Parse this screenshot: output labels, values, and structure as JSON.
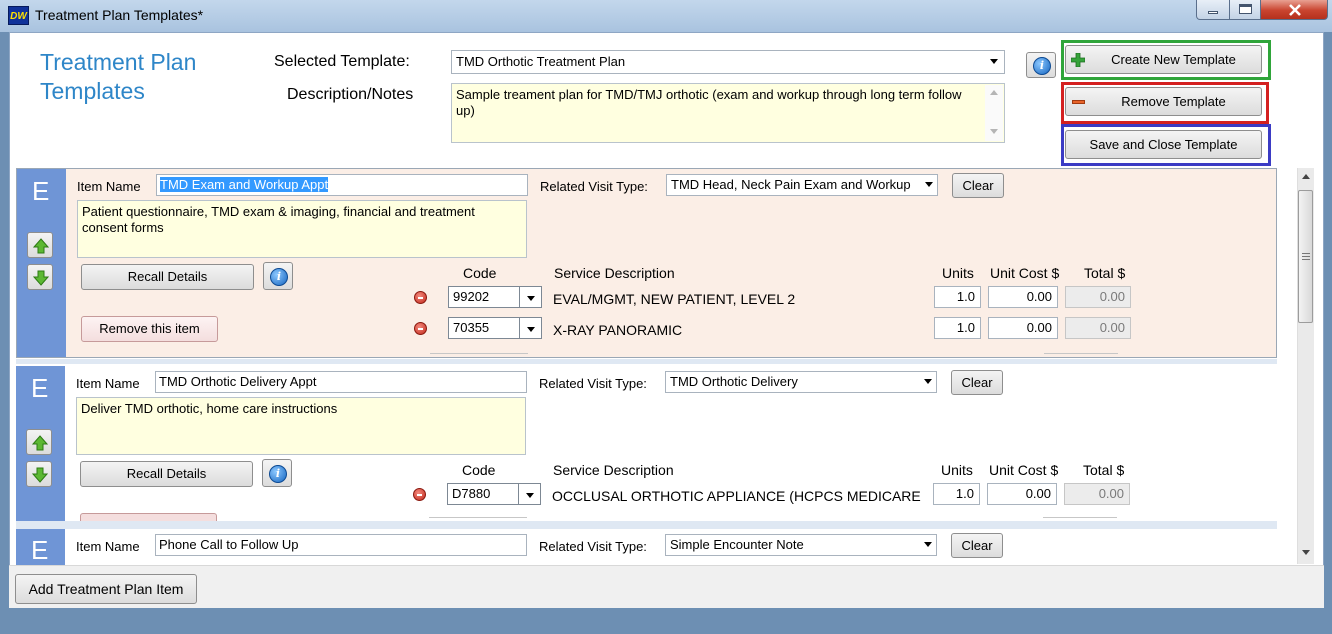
{
  "window": {
    "app_icon_text": "DW",
    "title": "Treatment Plan Templates*"
  },
  "header": {
    "page_title": "Treatment Plan Templates",
    "selected_template_label": "Selected Template:",
    "selected_template_value": "TMD Orthotic Treatment Plan",
    "description_label": "Description/Notes",
    "description_value": "Sample treament plan for TMD/TMJ orthotic (exam and workup through long term follow up)"
  },
  "actions": {
    "create_label": "Create New Template",
    "remove_label": "Remove Template",
    "save_label": "Save and Close Template",
    "highlight_colors": {
      "create": "#2fa53a",
      "remove": "#d42020",
      "save": "#3b3bc4"
    }
  },
  "labels": {
    "item_name": "Item Name",
    "related_visit_type": "Related Visit Type:",
    "clear": "Clear",
    "recall_details": "Recall Details",
    "remove_item": "Remove this item",
    "code": "Code",
    "service_description": "Service Description",
    "units": "Units",
    "unit_cost": "Unit Cost $",
    "total": "Total $",
    "letter": "E"
  },
  "items": [
    {
      "name": "TMD Exam and Workup Appt",
      "visit_type": "TMD Head, Neck Pain Exam and Workup",
      "notes": "Patient questionnaire, TMD exam & imaging, financial and treatment consent forms",
      "lines": [
        {
          "code": "99202",
          "description": "EVAL/MGMT, NEW PATIENT, LEVEL 2",
          "units": "1.0",
          "unit_cost": "0.00",
          "total": "0.00"
        },
        {
          "code": "70355",
          "description": "X-RAY PANORAMIC",
          "units": "1.0",
          "unit_cost": "0.00",
          "total": "0.00"
        }
      ]
    },
    {
      "name": "TMD Orthotic Delivery Appt",
      "visit_type": "TMD Orthotic Delivery",
      "notes": "Deliver TMD orthotic, home care instructions",
      "lines": [
        {
          "code": "D7880",
          "description": "OCCLUSAL ORTHOTIC APPLIANCE (HCPCS MEDICARE",
          "units": "1.0",
          "unit_cost": "0.00",
          "total": "0.00"
        }
      ]
    },
    {
      "name": "Phone Call to Follow Up",
      "visit_type": "Simple Encounter Note"
    }
  ],
  "footer": {
    "add_item_label": "Add Treatment Plan Item"
  },
  "icons": [
    "info-icon",
    "arrow-up-icon",
    "arrow-down-icon",
    "remove-line-icon",
    "plus-icon",
    "minus-icon",
    "dropdown-arrow-icon"
  ]
}
